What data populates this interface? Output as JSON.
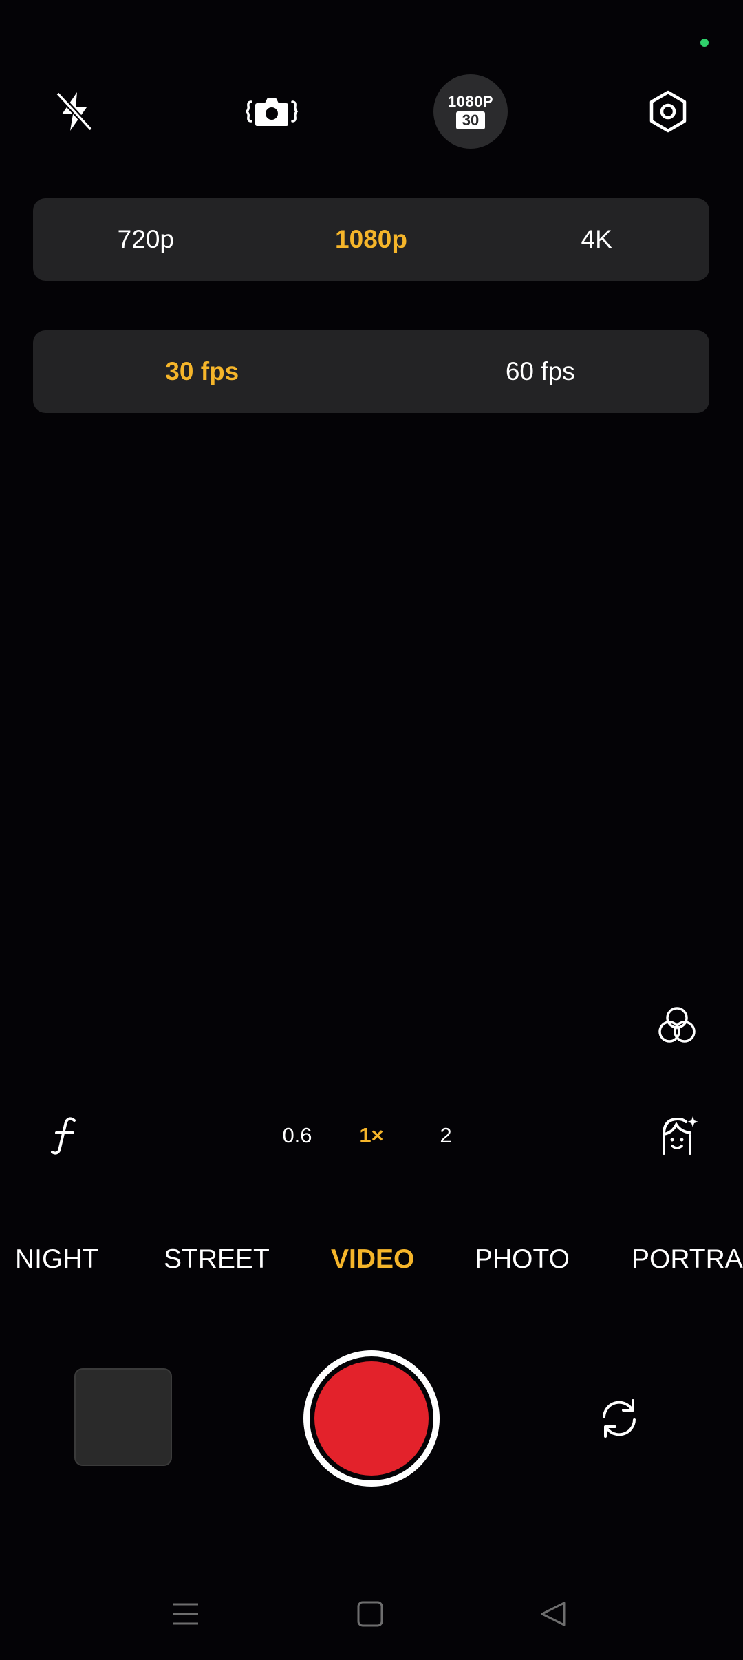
{
  "status": {
    "indicator_color": "#2fd16b"
  },
  "top_bar": {
    "flash_icon": "flash-off-icon",
    "stabilization_icon": "stabilization-icon",
    "resolution_badge": {
      "resolution": "1080P",
      "fps": "30"
    },
    "settings_icon": "settings-icon"
  },
  "resolution_options": [
    {
      "label": "720p",
      "active": false
    },
    {
      "label": "1080p",
      "active": true
    },
    {
      "label": "4K",
      "active": false
    }
  ],
  "fps_options": [
    {
      "label": "30 fps",
      "active": true
    },
    {
      "label": "60 fps",
      "active": false
    }
  ],
  "side_controls": {
    "filters_icon": "filters-icon",
    "aperture_icon": "aperture-f-icon",
    "beauty_icon": "beauty-face-icon"
  },
  "zoom": {
    "options": [
      "0.6",
      "1×",
      "2"
    ],
    "selected": "1×"
  },
  "modes": {
    "items": [
      "NIGHT",
      "STREET",
      "VIDEO",
      "PHOTO",
      "PORTRAIT"
    ],
    "selected": "VIDEO"
  },
  "bottom_controls": {
    "gallery": "gallery-thumbnail",
    "shutter": "record-button",
    "switch": "switch-camera-icon"
  },
  "navigation": {
    "menu_icon": "menu-icon",
    "home_icon": "home-icon",
    "back_icon": "back-icon"
  },
  "colors": {
    "background": "#040306",
    "accent": "#f5b52a",
    "panel": "#232325",
    "record": "#e3222b"
  }
}
